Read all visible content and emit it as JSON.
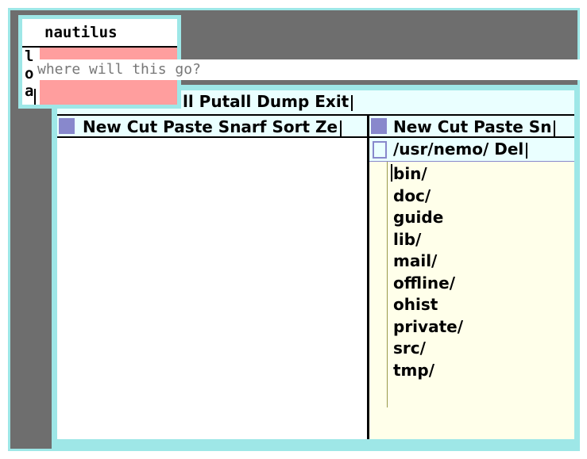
{
  "main_window": {
    "tag_text": "ll Putall Dump Exit"
  },
  "columns": [
    {
      "tag_text": "New Cut Paste Snarf Sort Ze"
    },
    {
      "tag_text": "New Cut Paste Sn"
    }
  ],
  "directory_window": {
    "tag_text": "/usr/nemo/ Del",
    "entries": [
      "bin/",
      "doc/",
      "guide",
      "lib/",
      "mail/",
      "offline/",
      "ohist",
      "private/",
      "src/",
      "tmp/"
    ]
  },
  "nautilus_window": {
    "title": "nautilus",
    "left_letters": [
      "l",
      "o",
      "a"
    ]
  },
  "overlay": {
    "text": "where will this go?"
  },
  "colors": {
    "frame": "#9ee7e7",
    "tag_bg": "#eaffff",
    "body_bg": "#ffffea",
    "box": "#8888cc",
    "selection": "#ff9e9e",
    "desktop": "#6e6e6e"
  }
}
